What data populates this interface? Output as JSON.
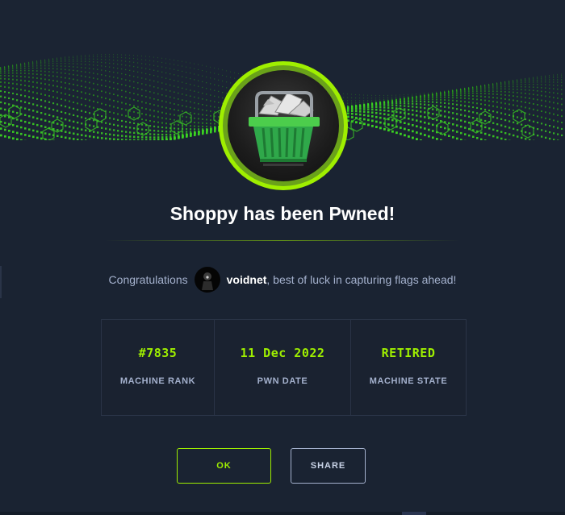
{
  "modal": {
    "title": "Shoppy has been Pwned!",
    "congrats_prefix": "Congratulations",
    "username": "voidnet",
    "congrats_suffix": ", best of luck in capturing flags ahead!",
    "stats": [
      {
        "value": "#7835",
        "label": "MACHINE RANK"
      },
      {
        "value": "11 Dec 2022",
        "label": "PWN DATE"
      },
      {
        "value": "RETIRED",
        "label": "MACHINE STATE"
      }
    ],
    "buttons": {
      "ok": "OK",
      "share": "SHARE"
    }
  },
  "icons": {
    "machine_logo": "shopping-basket-icon",
    "user_avatar": "user-avatar-icon"
  },
  "colors": {
    "accent": "#9fef00",
    "background": "#1a2332",
    "text_muted": "#a4b1cd",
    "text_primary": "#ffffff"
  }
}
